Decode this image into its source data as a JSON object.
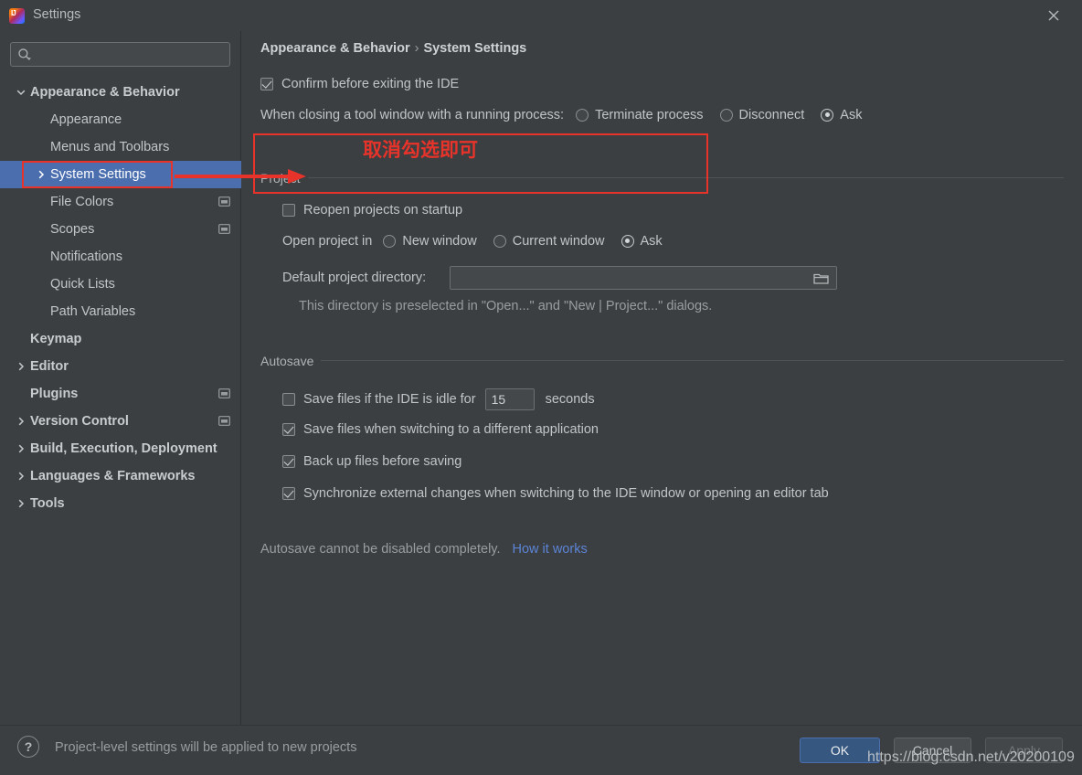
{
  "window": {
    "title": "Settings",
    "logo_icon": "intellij-idea-logo",
    "close_icon": "close-icon"
  },
  "sidebar": {
    "search": {
      "value": "",
      "placeholder": "",
      "icon": "search-icon"
    },
    "items": [
      {
        "label": "Appearance & Behavior",
        "indent": 0,
        "arrow": "expanded",
        "bold": true,
        "selected": false,
        "badge": false
      },
      {
        "label": "Appearance",
        "indent": 1,
        "arrow": "none",
        "bold": false,
        "selected": false,
        "badge": false
      },
      {
        "label": "Menus and Toolbars",
        "indent": 1,
        "arrow": "none",
        "bold": false,
        "selected": false,
        "badge": false
      },
      {
        "label": "System Settings",
        "indent": 1,
        "arrow": "collapsed",
        "bold": false,
        "selected": true,
        "badge": false
      },
      {
        "label": "File Colors",
        "indent": 1,
        "arrow": "none",
        "bold": false,
        "selected": false,
        "badge": true
      },
      {
        "label": "Scopes",
        "indent": 1,
        "arrow": "none",
        "bold": false,
        "selected": false,
        "badge": true
      },
      {
        "label": "Notifications",
        "indent": 1,
        "arrow": "none",
        "bold": false,
        "selected": false,
        "badge": false
      },
      {
        "label": "Quick Lists",
        "indent": 1,
        "arrow": "none",
        "bold": false,
        "selected": false,
        "badge": false
      },
      {
        "label": "Path Variables",
        "indent": 1,
        "arrow": "none",
        "bold": false,
        "selected": false,
        "badge": false
      },
      {
        "label": "Keymap",
        "indent": 0,
        "arrow": "none",
        "bold": true,
        "selected": false,
        "badge": false
      },
      {
        "label": "Editor",
        "indent": 0,
        "arrow": "collapsed",
        "bold": true,
        "selected": false,
        "badge": false
      },
      {
        "label": "Plugins",
        "indent": 0,
        "arrow": "none",
        "bold": true,
        "selected": false,
        "badge": true
      },
      {
        "label": "Version Control",
        "indent": 0,
        "arrow": "collapsed",
        "bold": true,
        "selected": false,
        "badge": true
      },
      {
        "label": "Build, Execution, Deployment",
        "indent": 0,
        "arrow": "collapsed",
        "bold": true,
        "selected": false,
        "badge": false
      },
      {
        "label": "Languages & Frameworks",
        "indent": 0,
        "arrow": "collapsed",
        "bold": true,
        "selected": false,
        "badge": false
      },
      {
        "label": "Tools",
        "indent": 0,
        "arrow": "collapsed",
        "bold": true,
        "selected": false,
        "badge": false
      }
    ]
  },
  "content": {
    "breadcrumb": {
      "root": "Appearance & Behavior",
      "separator": "›",
      "leaf": "System Settings"
    },
    "confirm_exit": {
      "label": "Confirm before exiting the IDE",
      "checked": true
    },
    "closing_tool_window": {
      "label": "When closing a tool window with a running process:",
      "options": [
        {
          "label": "Terminate process",
          "selected": false
        },
        {
          "label": "Disconnect",
          "selected": false
        },
        {
          "label": "Ask",
          "selected": true
        }
      ]
    },
    "project_group": {
      "title": "Project",
      "reopen": {
        "label": "Reopen projects on startup",
        "checked": false
      },
      "open_project_in": {
        "label": "Open project in",
        "options": [
          {
            "label": "New window",
            "selected": false
          },
          {
            "label": "Current window",
            "selected": false
          },
          {
            "label": "Ask",
            "selected": true
          }
        ]
      },
      "default_dir": {
        "label": "Default project directory:",
        "value": "",
        "browse_icon": "folder-icon"
      },
      "hint": "This directory is preselected in \"Open...\" and \"New | Project...\" dialogs."
    },
    "autosave_group": {
      "title": "Autosave",
      "items": [
        {
          "label": "Save files if the IDE is idle for",
          "checked": false,
          "has_field": true,
          "field_value": "15",
          "suffix": "seconds"
        },
        {
          "label": "Save files when switching to a different application",
          "checked": true,
          "has_field": false
        },
        {
          "label": "Back up files before saving",
          "checked": true,
          "has_field": false
        },
        {
          "label": "Synchronize external changes when switching to the IDE window or opening an editor tab",
          "checked": true,
          "has_field": false
        }
      ],
      "footer_note": "Autosave cannot be disabled completely.",
      "footer_link": "How it works"
    }
  },
  "annotations": {
    "text": "取消勾选即可",
    "color": "#e8332a",
    "arrow_icon": "red-arrow-right-icon"
  },
  "bottom": {
    "help_icon": "question-mark-icon",
    "note": "Project-level settings will be applied to new projects",
    "buttons": [
      {
        "label": "OK",
        "style": "primary",
        "enabled": true
      },
      {
        "label": "Cancel",
        "style": "default",
        "enabled": true
      },
      {
        "label": "Apply",
        "style": "disabled",
        "enabled": false
      }
    ]
  },
  "watermark": {
    "text": "https://blog.csdn.net/v20200109"
  },
  "colors": {
    "background": "#3c3f41",
    "selection": "#4b6eaf",
    "accent_button": "#365880",
    "link": "#5c84d6",
    "annotation": "#e8332a",
    "text": "#c2c5c7"
  }
}
